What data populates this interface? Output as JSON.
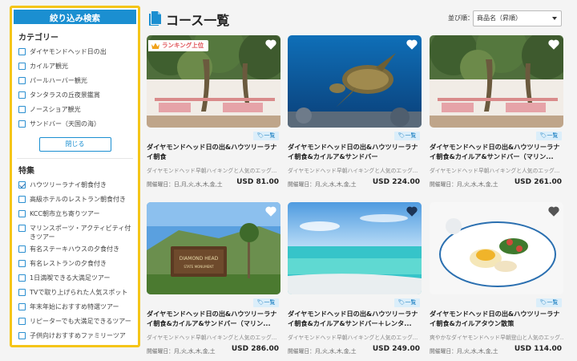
{
  "sidebar": {
    "title": "絞り込み検索",
    "category_heading": "カテゴリー",
    "categories": [
      {
        "label": "ダイヤモンドヘッド日の出",
        "checked": false
      },
      {
        "label": "カイルア観光",
        "checked": false
      },
      {
        "label": "パールハーバー観光",
        "checked": false
      },
      {
        "label": "タンタラスの丘夜景鑑賞",
        "checked": false
      },
      {
        "label": "ノースショア観光",
        "checked": false
      },
      {
        "label": "サンドバー（天国の海）",
        "checked": false
      }
    ],
    "close_label": "閉じる",
    "features_heading": "特集",
    "features": [
      {
        "label": "ハウツリーラナイ朝食付き",
        "checked": true
      },
      {
        "label": "高級ホテルのレストラン朝食付き",
        "checked": false
      },
      {
        "label": "KCC朝市立ち寄りツアー",
        "checked": false
      },
      {
        "label": "マリンスポーツ・アクティビティ付きツアー",
        "checked": false
      },
      {
        "label": "有名ステーキハウスの夕食付き",
        "checked": false
      },
      {
        "label": "有名レストランの夕食付き",
        "checked": false
      },
      {
        "label": "1日満喫できる大満足ツアー",
        "checked": false
      },
      {
        "label": "TVで取り上げられた人気スポット",
        "checked": false
      },
      {
        "label": "年末年始におすすめ特選ツアー",
        "checked": false
      },
      {
        "label": "リピーターでも大満足できるツアー",
        "checked": false
      },
      {
        "label": "子供向けおすすめファミリーツア",
        "checked": false
      }
    ]
  },
  "header": {
    "title": "コース一覧",
    "sort_label": "並び順：",
    "sort_value": "商品名（昇順）"
  },
  "ranking_label": "ランキング上位",
  "cards": [
    {
      "tag": "一覧",
      "title": "ダイヤモンドヘッド日の出&ハウツリーラナイ朝食",
      "desc": "ダイヤモンドヘッド早朝ハイキングと人気のエッグ...",
      "days": "開催曜日：日,月,火,水,木,金,土",
      "price": "USD 81.00",
      "image": "terrace",
      "ranking": true,
      "heart_color": "#ffffff"
    },
    {
      "tag": "一覧",
      "title": "ダイヤモンドヘッド日の出&ハウツリーラナイ朝食&カイルア&サンドバー",
      "desc": "ダイヤモンドヘッド早朝ハイキングと人気のエッグ...",
      "days": "開催曜日：月,火,水,木,金,土",
      "price": "USD 224.00",
      "image": "turtle",
      "ranking": false,
      "heart_color": "#ffffff"
    },
    {
      "tag": "一覧",
      "title": "ダイヤモンドヘッド日の出&ハウツリーラナイ朝食&カイルア&サンドバー（マリン...",
      "desc": "ダイヤモンドヘッド早朝ハイキングと人気のエッグ...",
      "days": "開催曜日：月,火,水,木,金,土",
      "price": "USD 261.00",
      "image": "terrace",
      "ranking": false,
      "heart_color": "#ffffff"
    },
    {
      "tag": "一覧",
      "title": "ダイヤモンドヘッド日の出&ハウツリーラナイ朝食&カイルア&サンドバー（マリン...",
      "desc": "ダイヤモンドヘッド早朝ハイキングと人気のエッグ...",
      "days": "開催曜日：月,火,水,木,金,土",
      "price": "USD 286.00",
      "image": "sign",
      "ranking": false,
      "heart_color": "#ffffff"
    },
    {
      "tag": "一覧",
      "title": "ダイヤモンドヘッド日の出&ハウツリーラナイ朝食&カイルア&サンドバー＋レンタ...",
      "desc": "ダイヤモンドヘッド早朝ハイキングと人気のエッグ...",
      "days": "開催曜日：月,火,水,木,金,土",
      "price": "USD 249.00",
      "image": "beach",
      "ranking": false,
      "heart_color": "#1d3557"
    },
    {
      "tag": "一覧",
      "title": "ダイヤモンドヘッド日の出&ハウツリーラナイ朝食&カイルアタウン散策",
      "desc": "爽やかなダイヤモンドヘッド早朝登山と人気のエッグ...",
      "days": "開催曜日：月,火,水,木,金,土",
      "price": "USD 114.00",
      "image": "food",
      "ranking": false,
      "heart_color": "#555555"
    }
  ]
}
